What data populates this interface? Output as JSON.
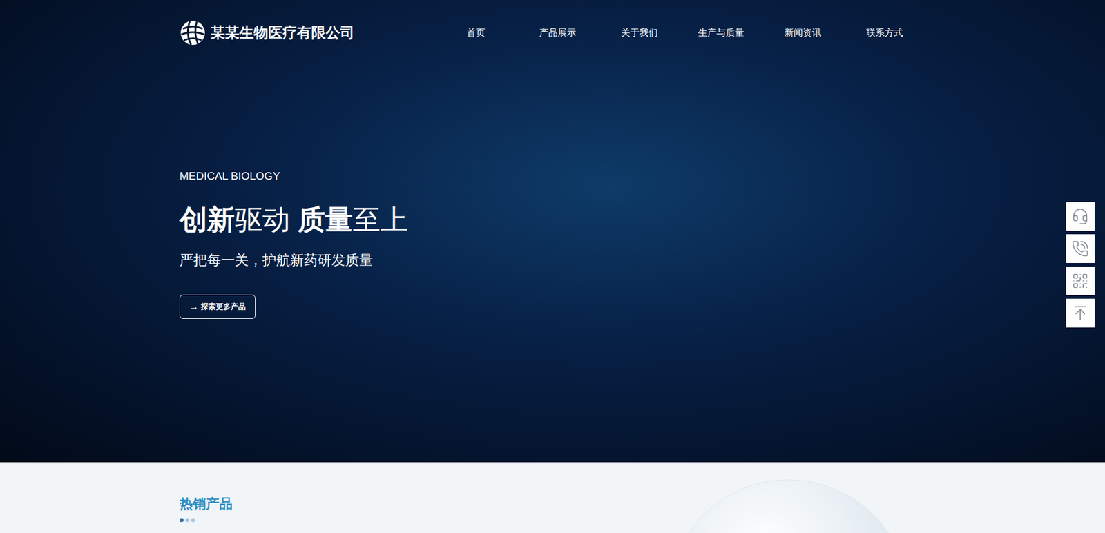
{
  "company": {
    "name": "某某生物医疗有限公司"
  },
  "nav": [
    "首页",
    "产品展示",
    "关于我们",
    "生产与质量",
    "新闻资讯",
    "联系方式"
  ],
  "hero": {
    "eyebrow": "MEDICAL BIOLOGY",
    "headline": [
      {
        "text": "创新",
        "bold": true
      },
      {
        "text": "驱动 ",
        "bold": false
      },
      {
        "text": "质量",
        "bold": true
      },
      {
        "text": "至上",
        "bold": false
      }
    ],
    "subtitle": "严把每一关，护航新药研发质量",
    "button": {
      "icon": "→",
      "label": "探索更多产品"
    }
  },
  "side_tools": [
    {
      "kind": "service"
    },
    {
      "kind": "phone"
    },
    {
      "kind": "qrcode"
    },
    {
      "kind": "top"
    }
  ],
  "section": {
    "title": "热销产品",
    "dots": [
      {
        "selected": true
      },
      {
        "selected": false
      },
      {
        "selected": false
      }
    ]
  }
}
